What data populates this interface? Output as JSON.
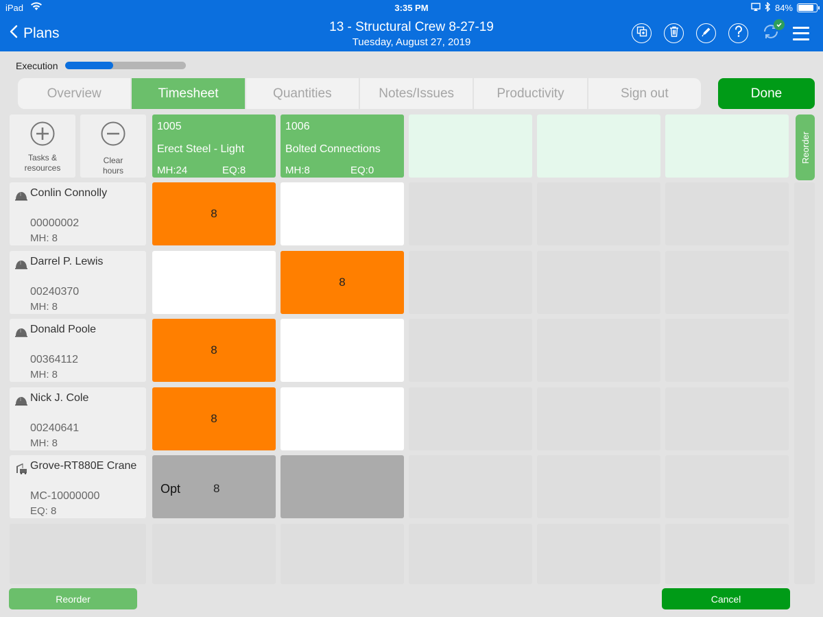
{
  "status_bar": {
    "carrier": "iPad",
    "time": "3:35 PM",
    "battery": "84%"
  },
  "header": {
    "back_label": "Plans",
    "title": "13 - Structural Crew 8-27-19",
    "subtitle": "Tuesday, August 27, 2019"
  },
  "execution": {
    "label": "Execution",
    "progress": 0.4
  },
  "tabs": [
    {
      "label": "Overview"
    },
    {
      "label": "Timesheet"
    },
    {
      "label": "Quantities"
    },
    {
      "label": "Notes/Issues"
    },
    {
      "label": "Productivity"
    },
    {
      "label": "Sign out"
    }
  ],
  "done_label": "Done",
  "tools": {
    "add_label": "Tasks & resources",
    "clear_label": "Clear hours"
  },
  "tasks": [
    {
      "code": "1005",
      "name": "Erect Steel - Light",
      "mh": "MH:24",
      "eq": "EQ:8"
    },
    {
      "code": "1006",
      "name": "Bolted Connections",
      "mh": "MH:8",
      "eq": "EQ:0"
    }
  ],
  "reorder_side_label": "Reorder",
  "resources": [
    {
      "name": "Conlin Connolly",
      "id": "00000002",
      "hours_label": "MH: 8",
      "type": "worker"
    },
    {
      "name": "Darrel P. Lewis",
      "id": "00240370",
      "hours_label": "MH: 8",
      "type": "worker"
    },
    {
      "name": "Donald Poole",
      "id": "00364112",
      "hours_label": "MH: 8",
      "type": "worker"
    },
    {
      "name": "Nick J. Cole",
      "id": "00240641",
      "hours_label": "MH: 8",
      "type": "worker"
    },
    {
      "name": "Grove-RT880E Crane",
      "id": "MC-10000000",
      "hours_label": "EQ:  8",
      "type": "equipment"
    }
  ],
  "hours": {
    "r0": [
      "8",
      ""
    ],
    "r1": [
      "",
      "8"
    ],
    "r2": [
      "8",
      ""
    ],
    "r3": [
      "8",
      ""
    ],
    "r4": [
      "8",
      ""
    ]
  },
  "equipment_opt_label": "Opt",
  "footer": {
    "reorder_label": "Reorder",
    "cancel_label": "Cancel"
  },
  "colors": {
    "primary": "#0b6fde",
    "task_green": "#6bbf6b",
    "done_green": "#009b17",
    "hours_orange": "#ff7f00"
  }
}
